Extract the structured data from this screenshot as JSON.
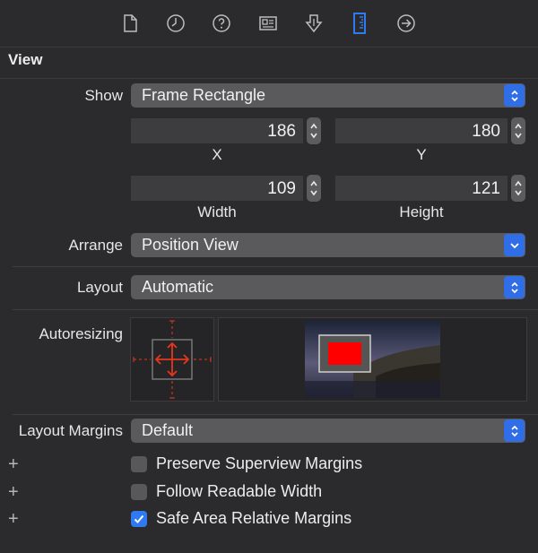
{
  "toolbar": {
    "icons": [
      "file-inspector-icon",
      "history-inspector-icon",
      "quick-help-icon",
      "identity-inspector-icon",
      "attributes-inspector-icon",
      "size-inspector-icon",
      "connections-inspector-icon"
    ]
  },
  "section": {
    "title": "View"
  },
  "show": {
    "label": "Show",
    "value": "Frame Rectangle"
  },
  "frame": {
    "x": "186",
    "y": "180",
    "width": "109",
    "height": "121",
    "x_label": "X",
    "y_label": "Y",
    "width_label": "Width",
    "height_label": "Height"
  },
  "arrange": {
    "label": "Arrange",
    "value": "Position View"
  },
  "layout": {
    "label": "Layout",
    "value": "Automatic"
  },
  "autoresizing": {
    "label": "Autoresizing"
  },
  "layout_margins": {
    "label": "Layout Margins",
    "value": "Default"
  },
  "options": [
    {
      "label": "Preserve Superview Margins",
      "checked": false
    },
    {
      "label": "Follow Readable Width",
      "checked": false
    },
    {
      "label": "Safe Area Relative Margins",
      "checked": true
    }
  ],
  "colors": {
    "accent": "#2f6ee6",
    "autoresize_red": "#e8361e",
    "preview_red": "#ff0000"
  }
}
